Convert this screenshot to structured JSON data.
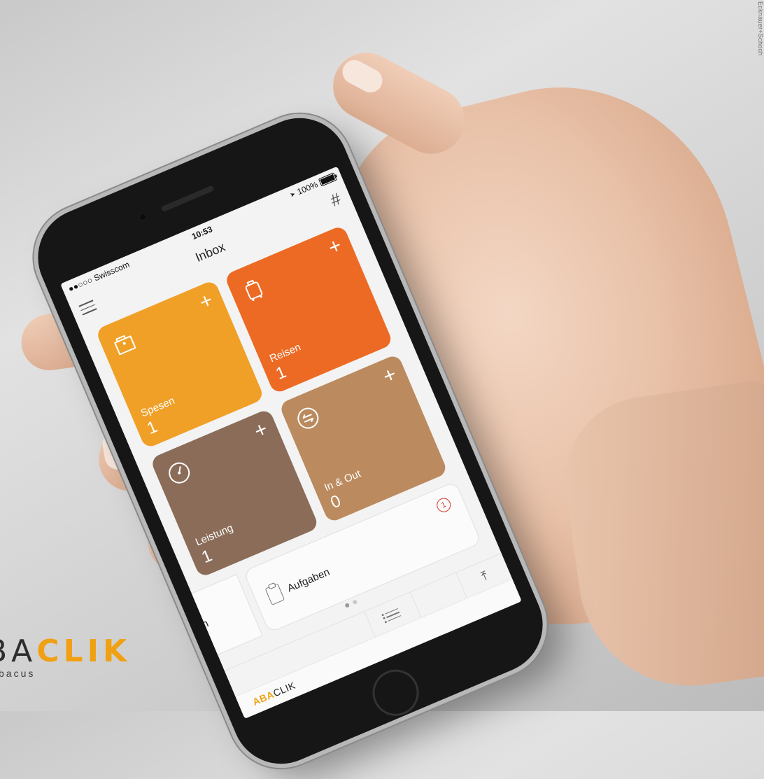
{
  "status_bar": {
    "carrier": "●●○○○ Swisscom",
    "time": "10:53",
    "battery": "100%"
  },
  "nav": {
    "title": "Inbox"
  },
  "tiles": [
    {
      "label": "Spesen",
      "count": "1",
      "color": "#f0a027"
    },
    {
      "label": "Reisen",
      "count": "1",
      "color": "#ec6a23"
    },
    {
      "label": "Leistung",
      "count": "1",
      "color": "#8a6c58"
    },
    {
      "label": "In & Out",
      "count": "0",
      "color": "#bb8a5e"
    }
  ],
  "cards": [
    {
      "label": "Nachrichten"
    },
    {
      "label": "Aufgaben",
      "badge": "1"
    }
  ],
  "tile_add_symbol": "+",
  "footer": {
    "brand_a": "ABA",
    "brand_b": "CLIK"
  },
  "branding": {
    "logo_a": "BA",
    "logo_b": "CLIK",
    "tagline": "bacus"
  },
  "credit": "Ecknauer+Schoch",
  "colors": {
    "accent_orange": "#f0a012",
    "badge_red": "#d9342b"
  }
}
